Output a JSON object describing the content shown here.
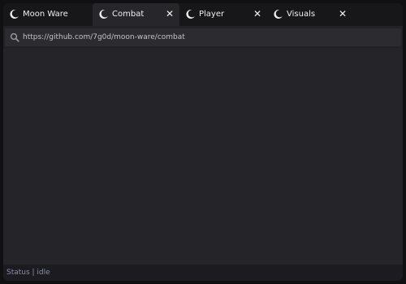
{
  "tabs": [
    {
      "label": "Moon Ware",
      "active": false,
      "closable": false,
      "icon": "crescent-moon-icon"
    },
    {
      "label": "Combat",
      "active": true,
      "closable": true,
      "icon": "crescent-moon-icon"
    },
    {
      "label": "Player",
      "active": false,
      "closable": true,
      "icon": "crescent-moon-icon"
    },
    {
      "label": "Visuals",
      "active": false,
      "closable": true,
      "icon": "crescent-moon-icon"
    }
  ],
  "tab_close_glyph": "✕",
  "address": {
    "value": "https://github.com/7g0d/moon-ware/combat",
    "icon": "search-icon"
  },
  "statusbar": {
    "text": "Status | idle"
  },
  "colors": {
    "background": "#222226",
    "tabbar": "#17171a",
    "active_tab": "#26262b",
    "status_text": "#8a8fa6"
  }
}
